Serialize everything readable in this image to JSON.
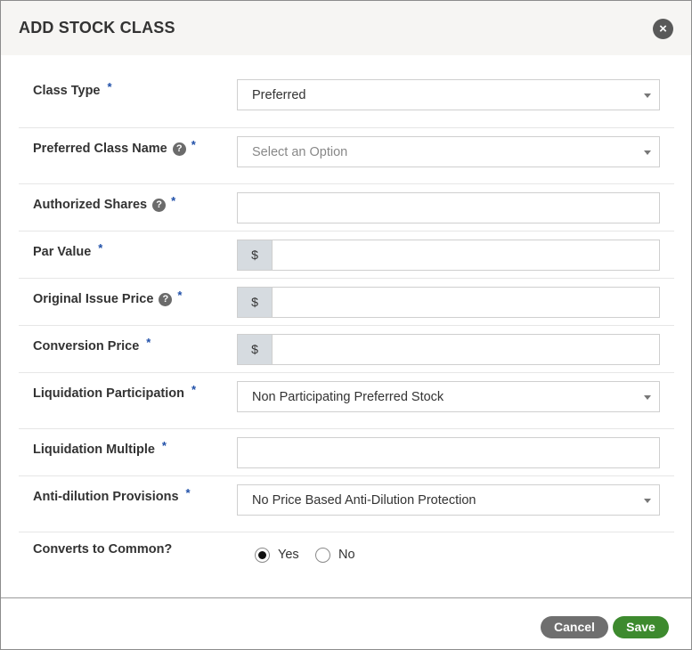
{
  "modal": {
    "title": "ADD STOCK CLASS",
    "close_icon": "×"
  },
  "fields": {
    "class_type": {
      "label": "Class Type",
      "required": "*",
      "value": "Preferred"
    },
    "preferred_class_name": {
      "label": "Preferred Class Name",
      "help": "?",
      "required": "*",
      "placeholder": "Select an Option"
    },
    "authorized_shares": {
      "label": "Authorized Shares",
      "help": "?",
      "required": "*",
      "value": ""
    },
    "par_value": {
      "label": "Par Value",
      "required": "*",
      "prefix": "$",
      "value": ""
    },
    "original_issue_price": {
      "label": "Original Issue Price",
      "help": "?",
      "required": "*",
      "prefix": "$",
      "value": ""
    },
    "conversion_price": {
      "label": "Conversion Price",
      "required": "*",
      "prefix": "$",
      "value": ""
    },
    "liquidation_participation": {
      "label": "Liquidation Participation",
      "required": "*",
      "value": "Non Participating Preferred Stock"
    },
    "liquidation_multiple": {
      "label": "Liquidation Multiple",
      "required": "*",
      "value": ""
    },
    "anti_dilution": {
      "label": "Anti-dilution Provisions",
      "required": "*",
      "value": "No Price Based Anti-Dilution Protection"
    },
    "converts_to_common": {
      "label": "Converts to Common?",
      "options": [
        {
          "label": "Yes",
          "selected": true
        },
        {
          "label": "No",
          "selected": false
        }
      ]
    }
  },
  "footer": {
    "cancel_label": "Cancel",
    "save_label": "Save"
  },
  "colors": {
    "header_bg": "#f6f5f3",
    "required_star": "#1f4fa8",
    "addon_bg": "#d6dbe0",
    "cancel_bg": "#6f6f6f",
    "save_bg": "#3d8a2e"
  }
}
